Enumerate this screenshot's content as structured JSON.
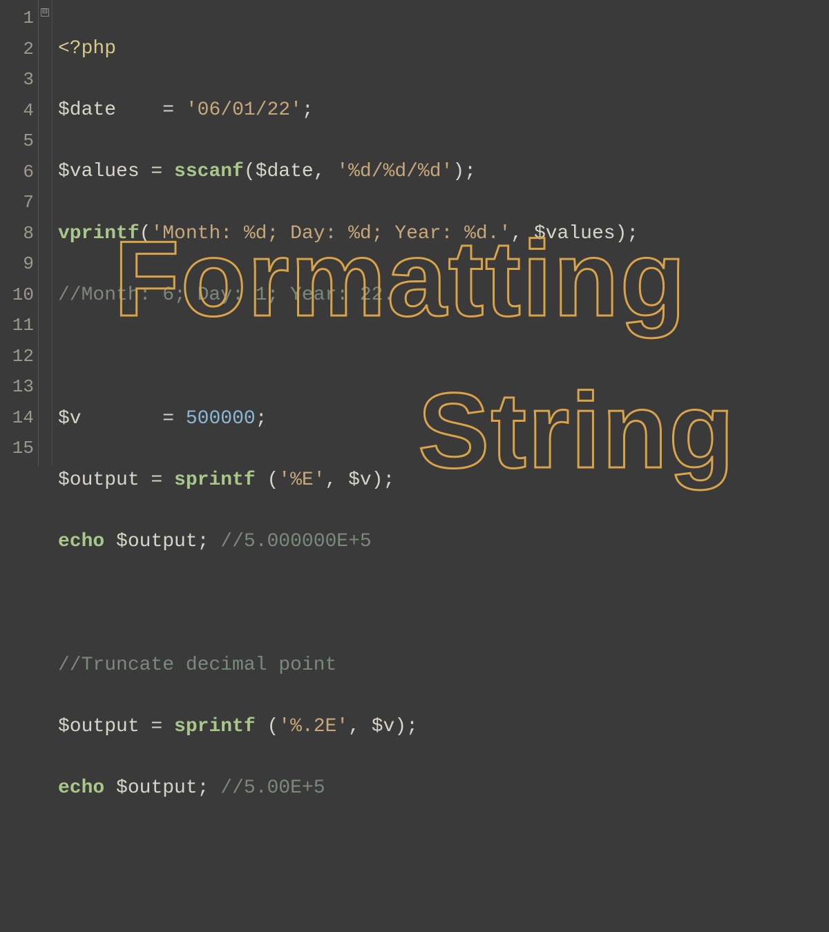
{
  "gutter": {
    "lines": [
      "1",
      "2",
      "3",
      "4",
      "5",
      "6",
      "7",
      "8",
      "9",
      "10",
      "11",
      "12",
      "13",
      "14",
      "15"
    ]
  },
  "fold_marker": "⊟",
  "code": {
    "l1": {
      "open_tag": "<?php"
    },
    "l2": {
      "var": "$date",
      "pad": "   ",
      "eq": " = ",
      "str": "'06/01/22'",
      "semi": ";"
    },
    "l3": {
      "var": "$values",
      "eq": " = ",
      "fn": "sscanf",
      "open": "(",
      "arg1": "$date",
      "comma": ", ",
      "str": "'%d/%d/%d'",
      "close": ")",
      "semi": ";"
    },
    "l4": {
      "fn": "vprintf",
      "open": "(",
      "str": "'Month: %d; Day: %d; Year: %d.'",
      "comma": ", ",
      "arg": "$values",
      "close": ")",
      "semi": ";"
    },
    "l5": {
      "comment": "//Month: 6; Day: 1; Year: 22."
    },
    "l7": {
      "var": "$v",
      "pad": "      ",
      "eq": " = ",
      "num": "500000",
      "semi": ";"
    },
    "l8": {
      "var": "$output",
      "eq": " = ",
      "fn": "sprintf",
      "sp": " ",
      "open": "(",
      "str": "'%E'",
      "comma": ", ",
      "arg": "$v",
      "close": ")",
      "semi": ";"
    },
    "l9": {
      "kw": "echo",
      "sp": " ",
      "var": "$output",
      "semi": ";",
      "sp2": " ",
      "comment": "//5.000000E+5"
    },
    "l11": {
      "comment": "//Truncate decimal point"
    },
    "l12": {
      "var": "$output",
      "eq": " = ",
      "fn": "sprintf",
      "sp": " ",
      "open": "(",
      "str": "'%.2E'",
      "comma": ", ",
      "arg": "$v",
      "close": ")",
      "semi": ";"
    },
    "l13": {
      "kw": "echo",
      "sp": " ",
      "var": "$output",
      "semi": ";",
      "sp2": " ",
      "comment": "//5.00E+5"
    }
  },
  "overlay": {
    "line1": "Formatting",
    "line2": "String"
  }
}
